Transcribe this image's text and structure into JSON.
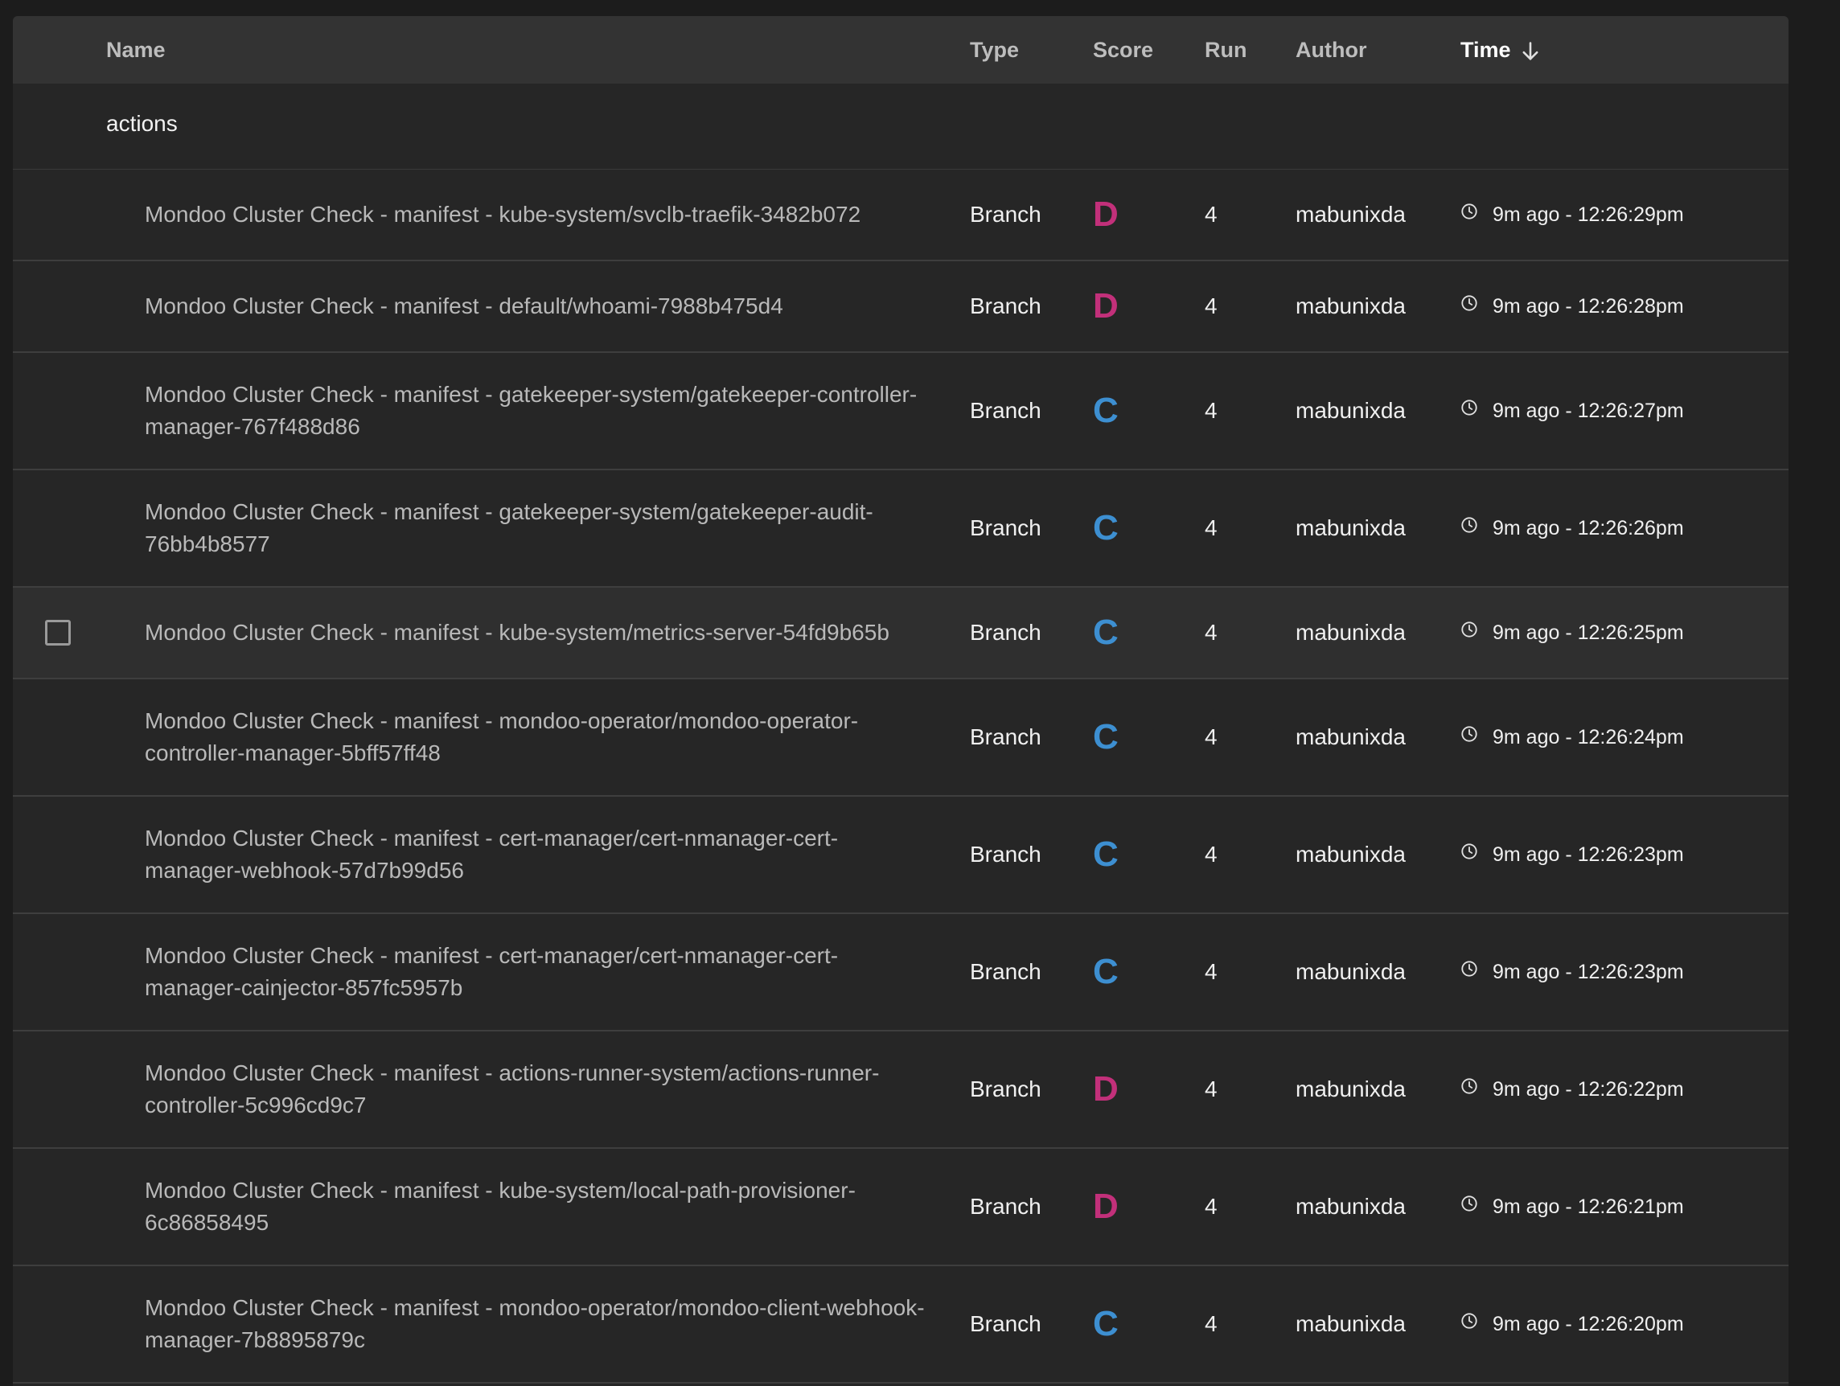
{
  "header": {
    "name": "Name",
    "type": "Type",
    "score": "Score",
    "run": "Run",
    "author": "Author",
    "time": "Time"
  },
  "group": {
    "label": "actions"
  },
  "colors": {
    "grade_d": "#c2307a",
    "grade_c": "#3d8fd1"
  },
  "rows": [
    {
      "name": "Mondoo Cluster Check - manifest - kube-system/svclb-traefik-3482b072",
      "type": "Branch",
      "score": "D",
      "run": "4",
      "author": "mabunixda",
      "time": "9m ago - 12:26:29pm"
    },
    {
      "name": "Mondoo Cluster Check - manifest - default/whoami-7988b475d4",
      "type": "Branch",
      "score": "D",
      "run": "4",
      "author": "mabunixda",
      "time": "9m ago - 12:26:28pm"
    },
    {
      "name": "Mondoo Cluster Check - manifest - gatekeeper-system/gatekeeper-controller-manager-767f488d86",
      "type": "Branch",
      "score": "C",
      "run": "4",
      "author": "mabunixda",
      "time": "9m ago - 12:26:27pm"
    },
    {
      "name": "Mondoo Cluster Check - manifest - gatekeeper-system/gatekeeper-audit-76bb4b8577",
      "type": "Branch",
      "score": "C",
      "run": "4",
      "author": "mabunixda",
      "time": "9m ago - 12:26:26pm"
    },
    {
      "name": "Mondoo Cluster Check - manifest - kube-system/metrics-server-54fd9b65b",
      "type": "Branch",
      "score": "C",
      "run": "4",
      "author": "mabunixda",
      "time": "9m ago - 12:26:25pm"
    },
    {
      "name": "Mondoo Cluster Check - manifest - mondoo-operator/mondoo-operator-controller-manager-5bff57ff48",
      "type": "Branch",
      "score": "C",
      "run": "4",
      "author": "mabunixda",
      "time": "9m ago - 12:26:24pm"
    },
    {
      "name": "Mondoo Cluster Check - manifest - cert-manager/cert-nmanager-cert-manager-webhook-57d7b99d56",
      "type": "Branch",
      "score": "C",
      "run": "4",
      "author": "mabunixda",
      "time": "9m ago - 12:26:23pm"
    },
    {
      "name": "Mondoo Cluster Check - manifest - cert-manager/cert-nmanager-cert-manager-cainjector-857fc5957b",
      "type": "Branch",
      "score": "C",
      "run": "4",
      "author": "mabunixda",
      "time": "9m ago - 12:26:23pm"
    },
    {
      "name": "Mondoo Cluster Check - manifest - actions-runner-system/actions-runner-controller-5c996cd9c7",
      "type": "Branch",
      "score": "D",
      "run": "4",
      "author": "mabunixda",
      "time": "9m ago - 12:26:22pm"
    },
    {
      "name": "Mondoo Cluster Check - manifest - kube-system/local-path-provisioner-6c86858495",
      "type": "Branch",
      "score": "D",
      "run": "4",
      "author": "mabunixda",
      "time": "9m ago - 12:26:21pm"
    },
    {
      "name": "Mondoo Cluster Check - manifest - mondoo-operator/mondoo-client-webhook-manager-7b8895879c",
      "type": "Branch",
      "score": "C",
      "run": "4",
      "author": "mabunixda",
      "time": "9m ago - 12:26:20pm"
    }
  ]
}
